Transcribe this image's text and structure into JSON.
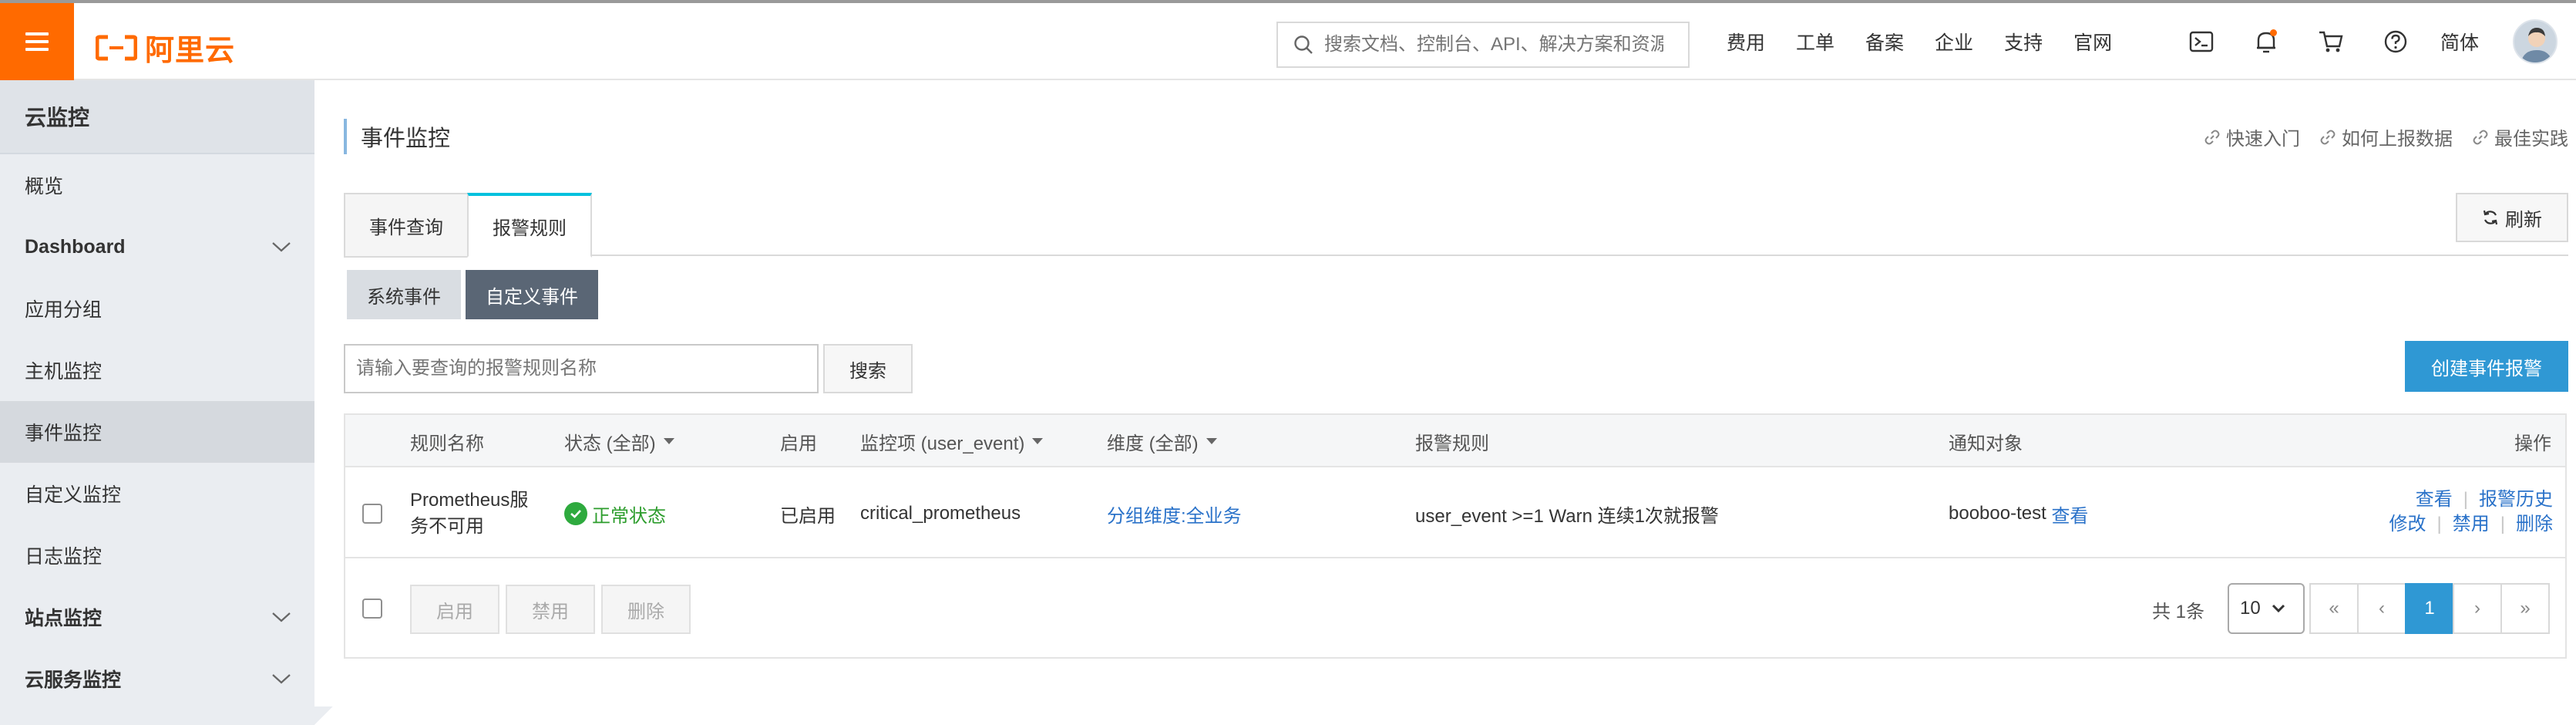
{
  "brand": {
    "logo_text": "阿里云",
    "accent": "#ff6a00"
  },
  "header": {
    "search_placeholder": "搜索文档、控制台、API、解决方案和资源",
    "nav": [
      "费用",
      "工单",
      "备案",
      "企业",
      "支持",
      "官网"
    ],
    "icons": [
      "terminal-icon",
      "bell-icon",
      "cart-icon",
      "help-icon"
    ],
    "language": "简体"
  },
  "sidebar": {
    "title": "云监控",
    "items": [
      {
        "label": "概览",
        "expandable": false
      },
      {
        "label": "Dashboard",
        "expandable": true
      },
      {
        "label": "应用分组",
        "expandable": false
      },
      {
        "label": "主机监控",
        "expandable": false
      },
      {
        "label": "事件监控",
        "expandable": false,
        "active": true
      },
      {
        "label": "自定义监控",
        "expandable": false
      },
      {
        "label": "日志监控",
        "expandable": false
      },
      {
        "label": "站点监控",
        "expandable": true
      },
      {
        "label": "云服务监控",
        "expandable": true
      }
    ]
  },
  "main": {
    "title": "事件监控",
    "help_links": [
      "快速入门",
      "如何上报数据",
      "最佳实践"
    ],
    "tabs": [
      "事件查询",
      "报警规则"
    ],
    "active_tab": "报警规则",
    "refresh_label": "刷新",
    "sub_tabs": [
      "系统事件",
      "自定义事件"
    ],
    "active_sub_tab": "自定义事件",
    "query_placeholder": "请输入要查询的报警规则名称",
    "search_label": "搜索",
    "create_label": "创建事件报警"
  },
  "table": {
    "columns": {
      "name": "规则名称",
      "status": "状态 (全部)",
      "enabled": "启用",
      "metric": "监控项 (user_event)",
      "dimension": "维度 (全部)",
      "rule": "报警规则",
      "notify": "通知对象",
      "actions": "操作"
    },
    "rows": [
      {
        "name": "Prometheus服务不可用",
        "status": "正常状态",
        "enabled": "已启用",
        "metric": "critical_prometheus",
        "dimension": "分组维度:全业务",
        "rule": "user_event >=1 Warn 连续1次就报警",
        "notify": "booboo-test",
        "notify_link": "查看",
        "actions": {
          "view": "查看",
          "history": "报警历史",
          "edit": "修改",
          "disable": "禁用",
          "delete": "删除"
        }
      }
    ],
    "bulk": {
      "enable": "启用",
      "disable": "禁用",
      "delete": "删除"
    },
    "total": "共 1条",
    "page_size": "10",
    "pager": {
      "first": "«",
      "prev": "‹",
      "current": "1",
      "next": "›",
      "last": "»"
    }
  }
}
